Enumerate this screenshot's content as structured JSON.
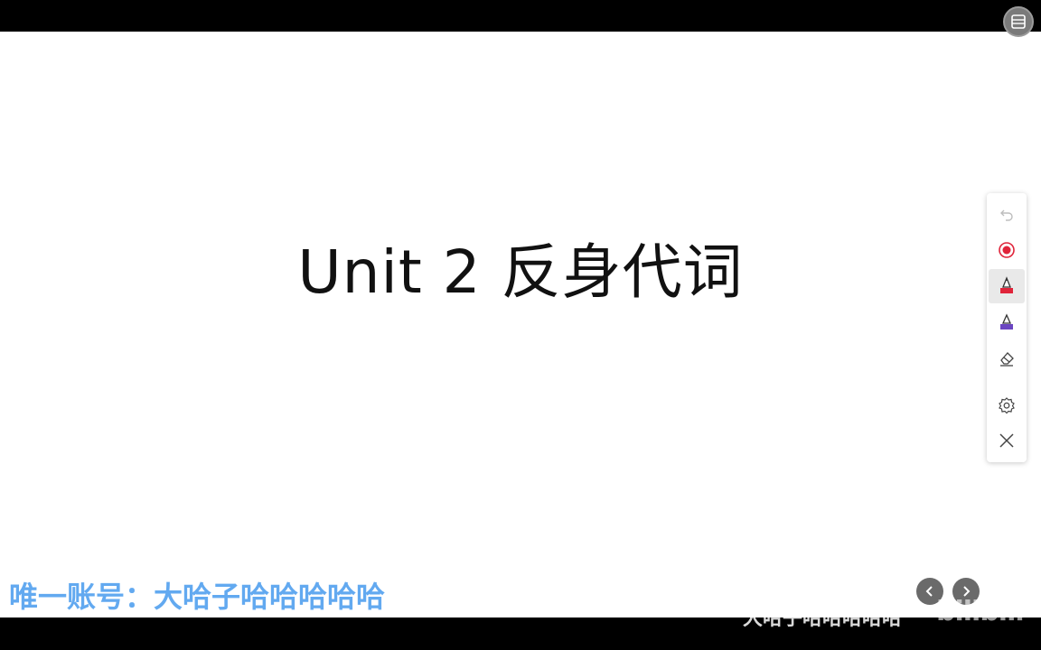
{
  "slide": {
    "title": "Unit 2 反身代词"
  },
  "toolbar": {
    "tools": [
      {
        "icon": "undo-icon",
        "state": "disabled"
      },
      {
        "icon": "record-icon",
        "color": "#e0243a"
      },
      {
        "icon": "red-pen-icon",
        "color": "#e0243a",
        "state": "selected"
      },
      {
        "icon": "purple-pen-icon",
        "color": "#6b46c1"
      },
      {
        "icon": "eraser-icon"
      },
      {
        "icon": "settings-icon"
      },
      {
        "icon": "close-icon"
      }
    ]
  },
  "overlay": {
    "watermark": "唯一账号：大哈子哈哈哈哈哈",
    "bottom_faded": "大哈子哈哈哈哈哈",
    "site_logo": "bilibili"
  },
  "nav": {
    "prev_icon": "chevron-left-icon",
    "next_icon": "chevron-right-icon"
  },
  "menu_icon": "menu-panel-icon"
}
